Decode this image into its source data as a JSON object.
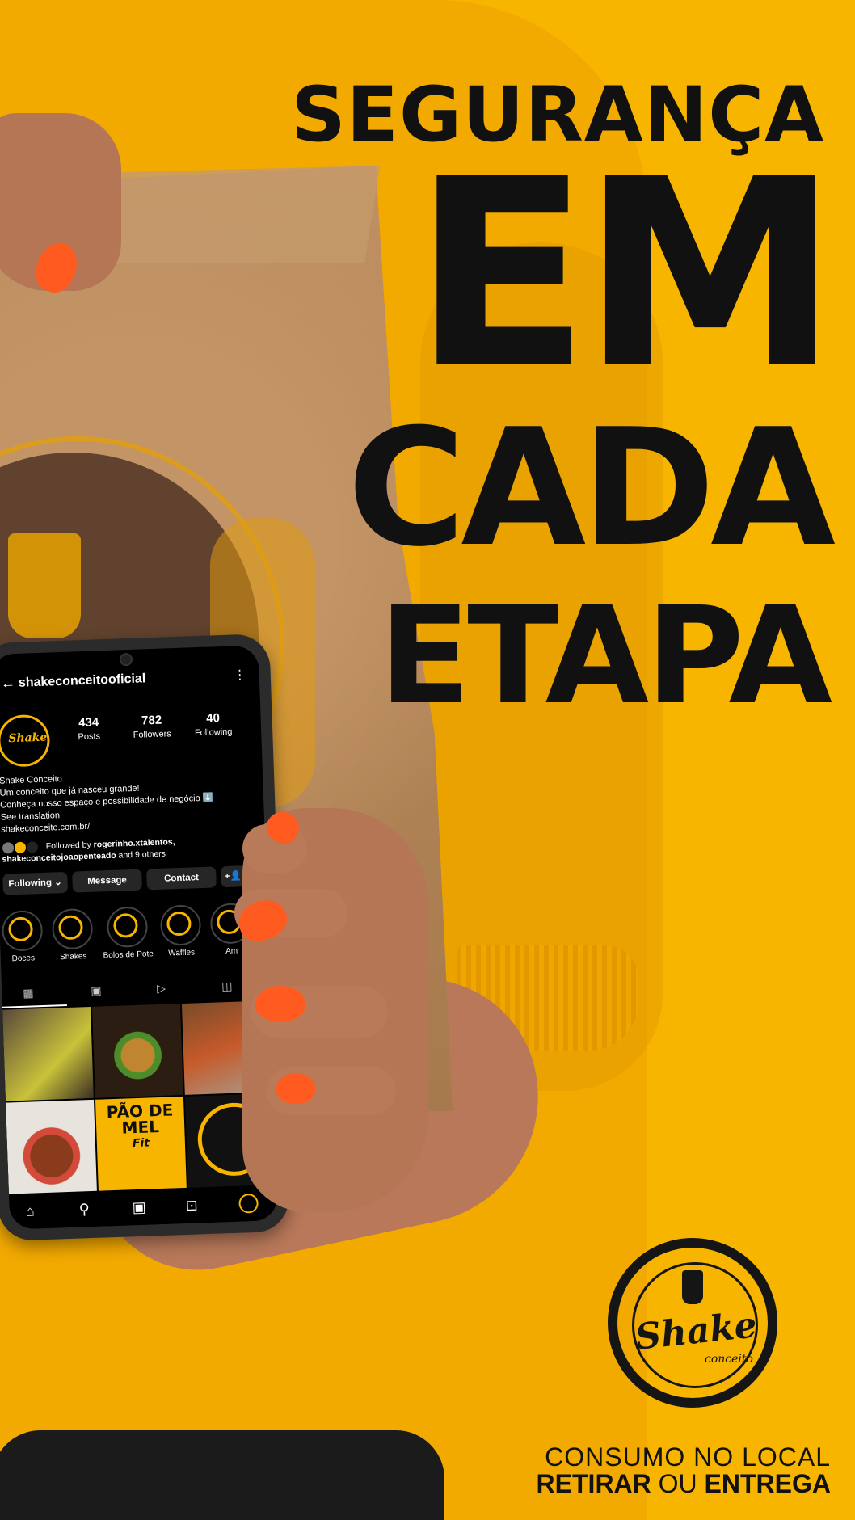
{
  "headline": {
    "line1": "SEGURANÇA",
    "line2": "EM",
    "line3": "CADA",
    "line4": "ETAPA"
  },
  "brand": {
    "logo_text": "Shake",
    "logo_sub": "conceito",
    "colors": {
      "background": "#f7b500",
      "text": "#111111",
      "nail": "#ff5a1f"
    }
  },
  "tagline": {
    "line1": "CONSUMO NO LOCAL",
    "retirar": "RETIRAR",
    "ou": " OU ",
    "entrega": "ENTREGA"
  },
  "phone": {
    "username": "shakeconceitooficial",
    "back_icon": "arrow-back-icon",
    "more_icon": "more-vertical-icon",
    "avatar_text": "Shake",
    "stats": [
      {
        "number": "434",
        "label": "Posts"
      },
      {
        "number": "782",
        "label": "Followers"
      },
      {
        "number": "40",
        "label": "Following"
      }
    ],
    "bio": {
      "name": "Shake Conceito",
      "line1": "Um conceito que já nasceu grande!",
      "line2": "Conheça nosso espaço e possibilidade de negócio ⬇️",
      "translation": "See translation",
      "link": "shakeconceito.com.br/"
    },
    "followed_by": {
      "prefix": "Followed by ",
      "names": "rogerinho.xtalentos, shakeconceitojoaopenteado",
      "suffix": " and 9 others"
    },
    "buttons": {
      "following": "Following ⌄",
      "message": "Message",
      "contact": "Contact",
      "add_person": "+👤"
    },
    "highlights": [
      {
        "label": "Doces"
      },
      {
        "label": "Shakes"
      },
      {
        "label": "Bolos de Pote"
      },
      {
        "label": "Waffles"
      },
      {
        "label": "Am"
      }
    ],
    "grid_text": {
      "pao_line1": "PÃO DE",
      "pao_line2": "MEL",
      "pao_line3": "Fit"
    },
    "tab_icons": [
      "grid-icon",
      "reels-icon",
      "play-icon",
      "tagged-icon"
    ],
    "nav_icons": [
      "home-icon",
      "search-icon",
      "reels-icon",
      "shop-icon",
      "profile-icon"
    ]
  }
}
